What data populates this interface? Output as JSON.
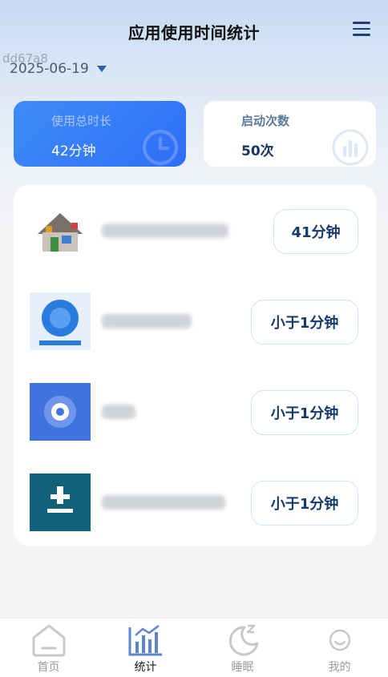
{
  "header": {
    "title": "应用使用时间统计"
  },
  "watermark": "dd67a8",
  "date": "2025-06-19",
  "stats": {
    "usage": {
      "label": "使用总时长",
      "value": "42分钟"
    },
    "launches": {
      "label": "启动次数",
      "value": "50次"
    }
  },
  "apps": [
    {
      "icon": "launcher-house-icon",
      "duration": "41分钟"
    },
    {
      "icon": "blue-clock-app-icon",
      "duration": "小于1分钟"
    },
    {
      "icon": "settings-gear-app-icon",
      "duration": "小于1分钟"
    },
    {
      "icon": "installer-download-app-icon",
      "duration": "小于1分钟"
    }
  ],
  "tabs": [
    {
      "label": "首页",
      "icon": "home-icon",
      "active": false
    },
    {
      "label": "统计",
      "icon": "stats-chart-icon",
      "active": true
    },
    {
      "label": "睡眠",
      "icon": "moon-sleep-icon",
      "active": false
    },
    {
      "label": "我的",
      "icon": "smiley-profile-icon",
      "active": false
    }
  ],
  "colors": {
    "accent_blue": "#2f6ef6",
    "title_text": "#111111",
    "button_text": "#163a6b",
    "tab_active": "#5b86c9",
    "tab_inactive": "#c8c8c8"
  }
}
